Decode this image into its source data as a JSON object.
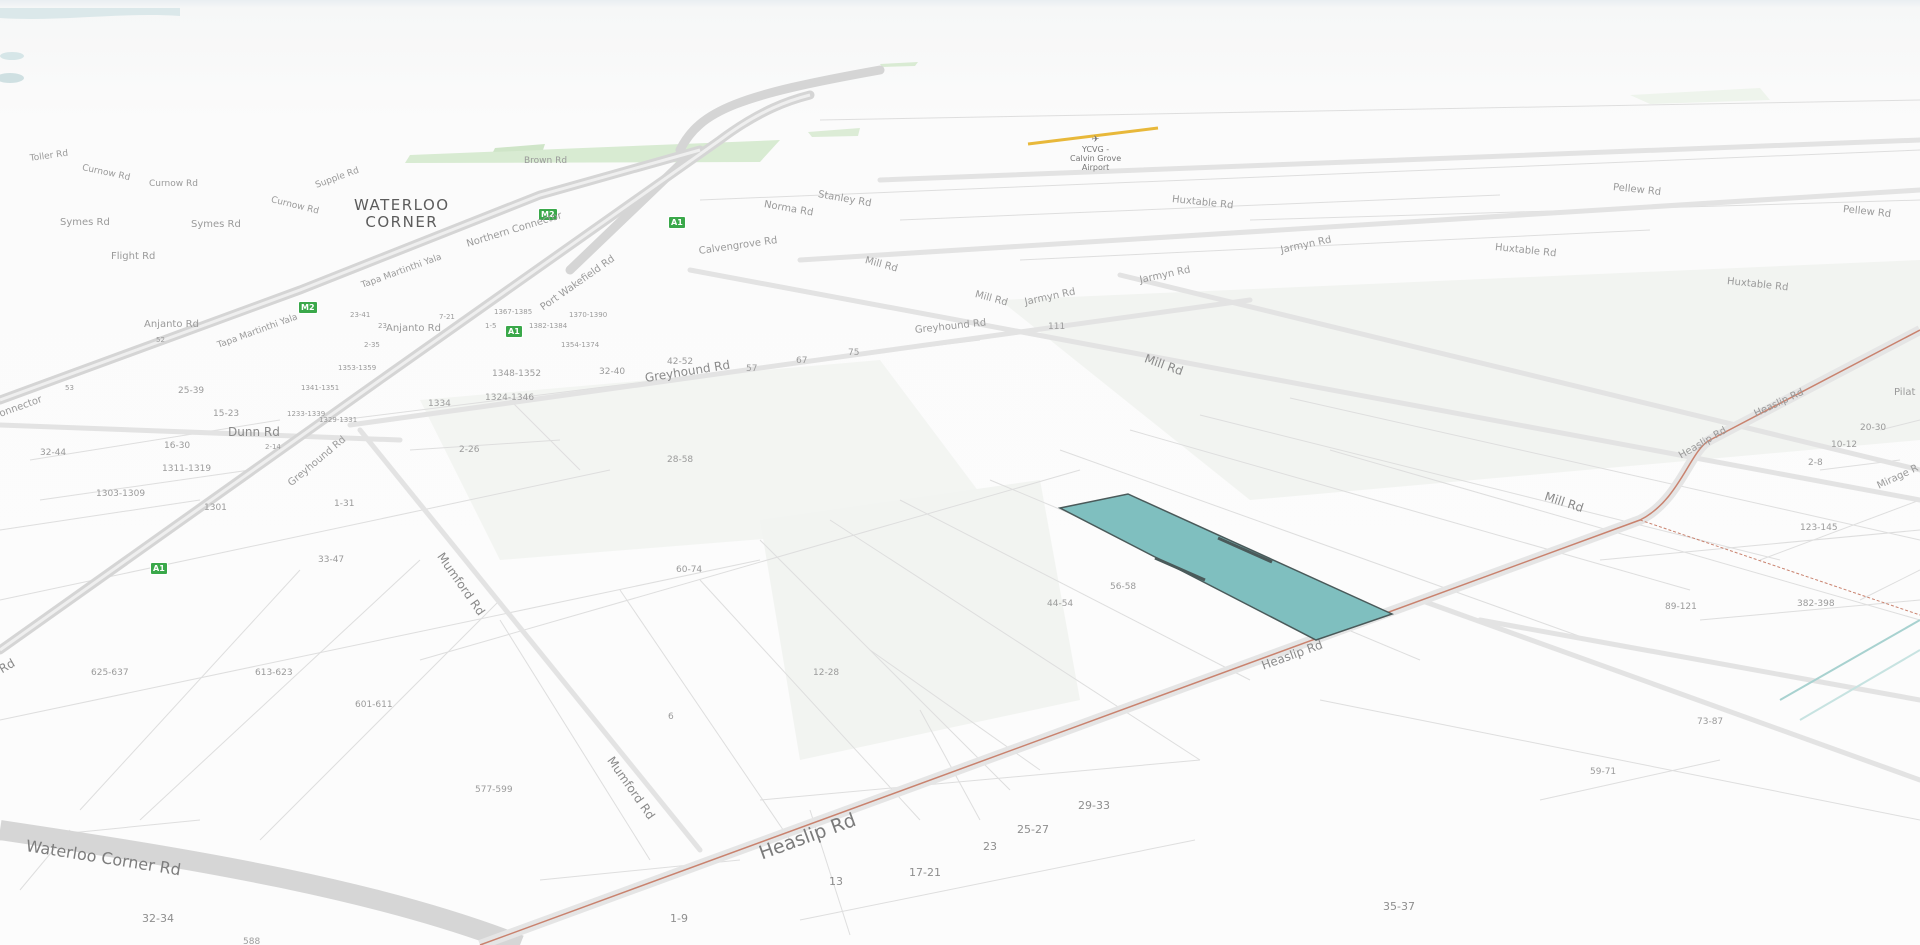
{
  "map": {
    "suburb": {
      "line1": "WATERLOO",
      "line2": "CORNER"
    },
    "airport": {
      "line1": "YCVG -",
      "line2": "Calvin Grove",
      "line3": "Airport"
    },
    "colors": {
      "highlight_parcel": "#7fbfbf",
      "main_road": "#c9826e",
      "greenspace": "#d8ebd2",
      "background": "#fbfbfb"
    },
    "shields": {
      "m2": "M2",
      "a1": "A1"
    },
    "roads": {
      "heaslip": "Heaslip Rd",
      "mill": "Mill Rd",
      "greyhound": "Greyhound Rd",
      "mumford": "Mumford Rd",
      "waterloo_corner": "Waterloo Corner Rd",
      "dunn": "Dunn Rd",
      "anjanto": "Anjanto Rd",
      "port_wakefield": "Port Wakefield Rd",
      "northern_connector": "Northern Connector",
      "tapa_martinthi_yala": "Tapa Martinthi Yala",
      "huxtable": "Huxtable Rd",
      "jarmyn": "Jarmyn Rd",
      "calvengrove": "Calvengrove Rd",
      "stanley": "Stanley Rd",
      "norma": "Norma Rd",
      "pellew": "Pellew Rd",
      "symes": "Symes Rd",
      "flight": "Flight Rd",
      "brown": "Brown Rd",
      "supple": "Supple Rd",
      "curnow": "Curnow Rd",
      "toller": "Toller Rd",
      "mirage": "Mirage R",
      "pilat": "Pilat",
      "connector_fragment": "onnector",
      "rd_fragment": "Rd"
    },
    "lots": {
      "l35_37": "35-37",
      "l1_9": "1-9",
      "l13": "13",
      "l17_21": "17-21",
      "l23": "23",
      "l25_27": "25-27",
      "l29_33": "29-33",
      "l6": "6",
      "l12_28": "12-28",
      "l577_599": "577-599",
      "l601_611": "601-611",
      "l613_623": "613-623",
      "l625_637": "625-637",
      "l32_34": "32-34",
      "l588": "588",
      "l60_74": "60-74",
      "l44_54": "44-54",
      "l56_58": "56-58",
      "l28_58": "28-58",
      "l2_26": "2-26",
      "l1_31": "1-31",
      "l33_47": "33-47",
      "l1301": "1301",
      "l1303_1309": "1303-1309",
      "l1311_1319": "1311-1319",
      "l16_30": "16-30",
      "l32_44": "32-44",
      "l15_23": "15-23",
      "l25_39": "25-39",
      "l1334": "1334",
      "l1324_1346": "1324-1346",
      "l1348_1352": "1348-1352",
      "l32_40": "32-40",
      "l42_52": "42-52",
      "l57": "57",
      "l67": "67",
      "l75": "75",
      "l111": "111",
      "l123_145": "123-145",
      "l89_121": "89-121",
      "l382_398": "382-398",
      "l73_87": "73-87",
      "l59_71": "59-71",
      "l10_12": "10-12",
      "l20_30": "20-30",
      "l2_8": "2-8",
      "l1233_1339": "1233-1339",
      "l1329_1331": "1329-1331",
      "l1341_1351": "1341-1351",
      "l1353_1359": "1353-1359",
      "l1354_1374": "1354-1374",
      "l1370_1390": "1370-1390",
      "l1382_1384": "1382-1384",
      "l1367_1385": "1367-1385",
      "l2_14": "2-14",
      "l53": "53",
      "l52": "52",
      "l2_35": "2-35",
      "l7_21": "7-21",
      "l1_5": "1-5",
      "l23b": "23",
      "l23_41": "23-41"
    }
  }
}
